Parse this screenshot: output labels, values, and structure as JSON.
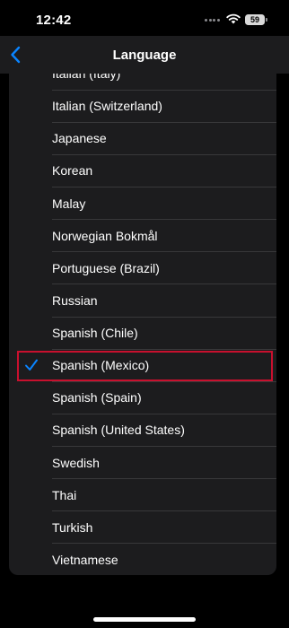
{
  "status_bar": {
    "time": "12:42",
    "battery": "59"
  },
  "nav": {
    "title": "Language",
    "back_icon": "chevron-left-icon"
  },
  "languages": [
    "Italian (Italy)",
    "Italian (Switzerland)",
    "Japanese",
    "Korean",
    "Malay",
    "Norwegian Bokmål",
    "Portuguese (Brazil)",
    "Russian",
    "Spanish (Chile)",
    "Spanish (Mexico)",
    "Spanish (Spain)",
    "Spanish (United States)",
    "Swedish",
    "Thai",
    "Turkish",
    "Vietnamese"
  ],
  "selected": "Spanish (Mexico)",
  "colors": {
    "accent": "#0a84ff",
    "highlight": "#c8102e",
    "background": "#000000",
    "cell": "#1c1c1e"
  }
}
